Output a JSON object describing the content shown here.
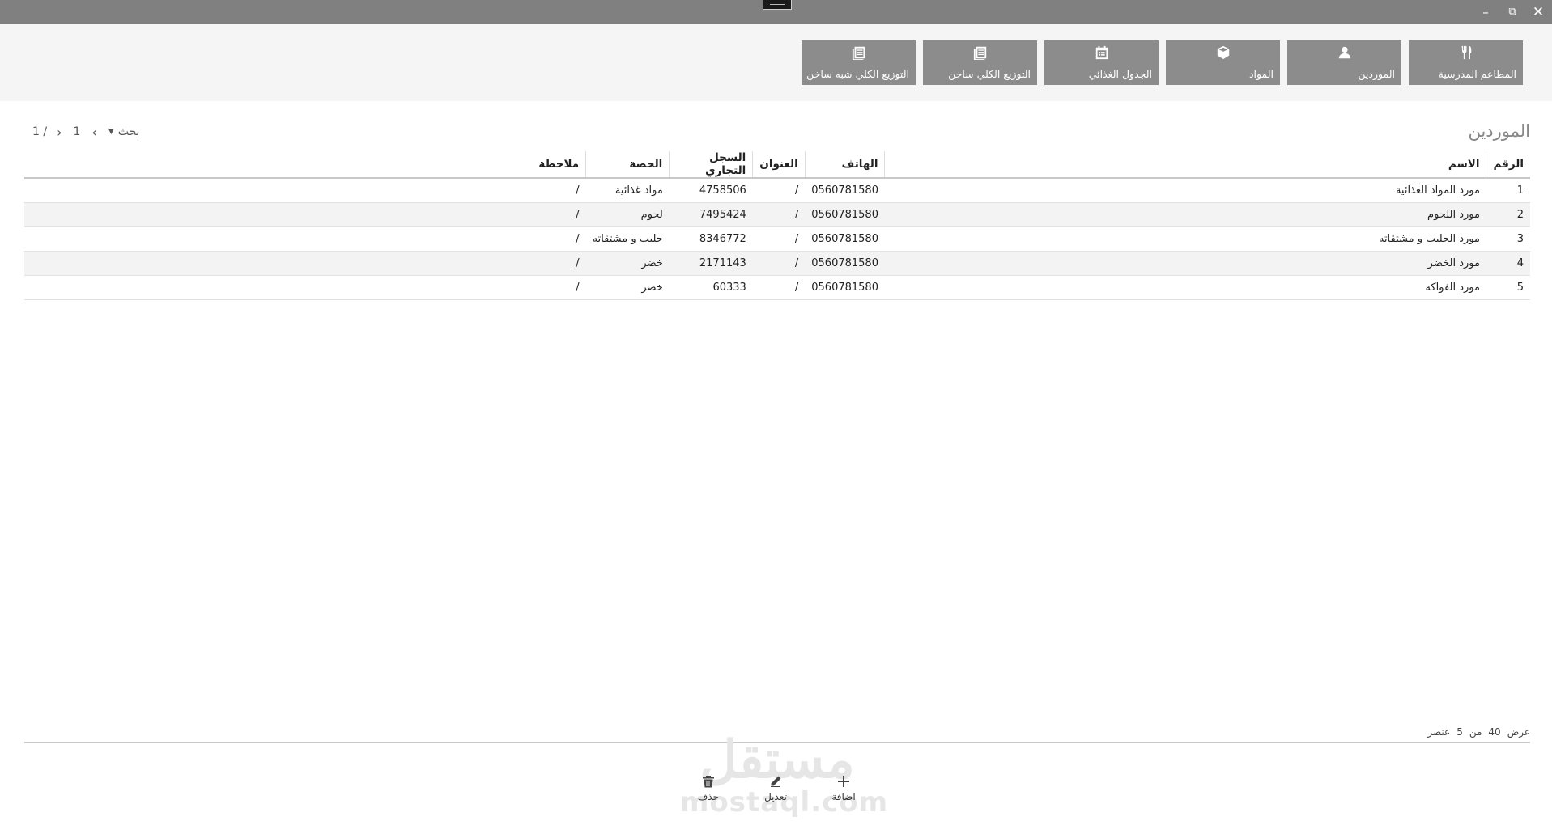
{
  "window": {
    "controls": {
      "minimize": "–",
      "maximize": "⧉",
      "close": "✕"
    }
  },
  "toolbar": {
    "tiles": [
      {
        "label": "المطاعم المدرسية",
        "icon": "cutlery-icon"
      },
      {
        "label": "الموردين",
        "icon": "user-icon"
      },
      {
        "label": "المواد",
        "icon": "cube-icon"
      },
      {
        "label": "الجدول الغذائي",
        "icon": "calendar-icon"
      },
      {
        "label": "التوزيع الكلي ساخن",
        "icon": "document-list-icon"
      },
      {
        "label": "التوزيع الكلي شبه ساخن",
        "icon": "document-list-icon"
      }
    ],
    "tile_color": "#8c8c8c"
  },
  "main": {
    "title": "الموردين",
    "pager": {
      "search_label": "بحث",
      "current_page": "1",
      "total": "1 /"
    },
    "table": {
      "headers": {
        "num": "الرقم",
        "name": "الاسم",
        "phone": "الهاتف",
        "address": "العنوان",
        "register": "السجل التجاري",
        "share": "الحصة",
        "note": "ملاحظة"
      },
      "rows": [
        {
          "num": "1",
          "name": "مورد المواد الغذائية",
          "phone": "0560781580",
          "address": "/",
          "register": "4758506",
          "share": "مواد غذائية",
          "note": "/"
        },
        {
          "num": "2",
          "name": "مورد اللحوم",
          "phone": "0560781580",
          "address": "/",
          "register": "7495424",
          "share": "لحوم",
          "note": "/"
        },
        {
          "num": "3",
          "name": "مورد الحليب و مشتقاته",
          "phone": "0560781580",
          "address": "/",
          "register": "8346772",
          "share": "حليب و مشتقاته",
          "note": "/"
        },
        {
          "num": "4",
          "name": "مورد الخضر",
          "phone": "0560781580",
          "address": "/",
          "register": "2171143",
          "share": "خضر",
          "note": "/"
        },
        {
          "num": "5",
          "name": "مورد الفواكه",
          "phone": "0560781580",
          "address": "/",
          "register": "60333",
          "share": "خضر",
          "note": "/"
        }
      ]
    },
    "count": {
      "show": "عرض",
      "shown": "40",
      "of": "من",
      "total": "5",
      "unit": "عنصر"
    }
  },
  "actions": {
    "add": "اضافة",
    "edit": "تعديل",
    "delete": "حذف"
  },
  "watermark": {
    "arabic": "مستقل",
    "latin": "mostaql.com"
  }
}
